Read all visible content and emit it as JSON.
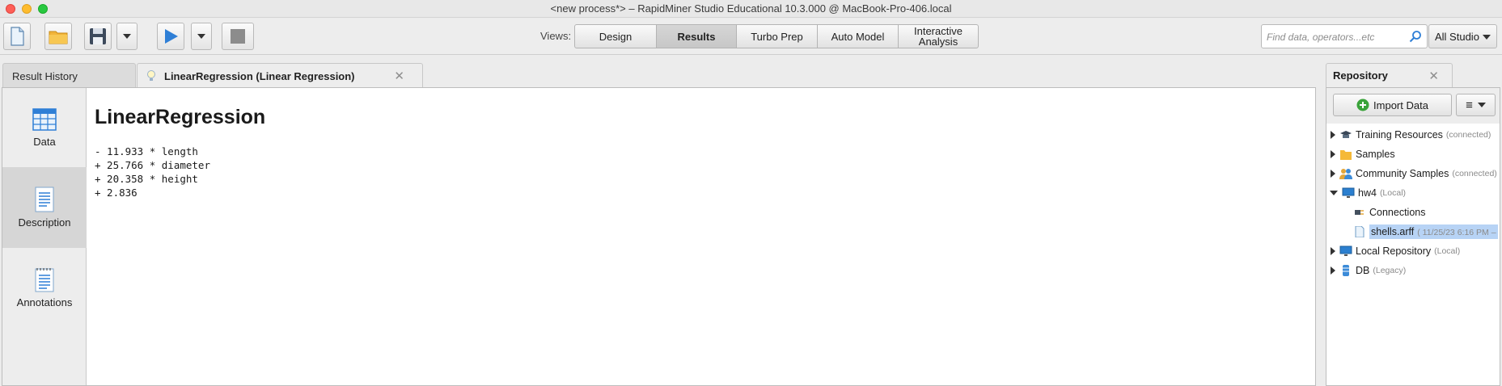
{
  "window": {
    "title": "<new process*> – RapidMiner Studio Educational 10.3.000 @ MacBook-Pro-406.local"
  },
  "toolbar": {
    "views_label": "Views:",
    "views": [
      {
        "label": "Design",
        "active": false
      },
      {
        "label": "Results",
        "active": true
      },
      {
        "label": "Turbo Prep",
        "active": false
      },
      {
        "label": "Auto Model",
        "active": false
      },
      {
        "label": "Interactive Analysis",
        "active": false
      }
    ],
    "search_placeholder": "Find data, operators...etc",
    "studio_dropdown": "All Studio"
  },
  "results": {
    "tabs": [
      {
        "label": "Result History"
      },
      {
        "label": "LinearRegression (Linear Regression)",
        "close": "✕"
      }
    ],
    "sidebar": [
      {
        "label": "Data"
      },
      {
        "label": "Description"
      },
      {
        "label": "Annotations"
      }
    ],
    "model_title": "LinearRegression",
    "formula_lines": [
      "- 11.933 * length",
      "+ 25.766 * diameter",
      "+ 20.358 * height",
      "+ 2.836"
    ]
  },
  "repository": {
    "tab_label": "Repository",
    "tab_close": "✕",
    "import_label": "Import Data",
    "menu_icon": "≡",
    "items": [
      {
        "label": "Training Resources",
        "sub": "(connected)"
      },
      {
        "label": "Samples",
        "sub": ""
      },
      {
        "label": "Community Samples",
        "sub": "(connected)"
      },
      {
        "label": "hw4",
        "sub": "(Local)"
      },
      {
        "label": "Connections",
        "sub": ""
      },
      {
        "label": "shells.arff",
        "sub": "( 11/25/23 6:16 PM –"
      },
      {
        "label": "Local Repository",
        "sub": "(Local)"
      },
      {
        "label": "DB",
        "sub": "(Legacy)"
      }
    ]
  },
  "colors": {
    "accent_blue": "#2f7fd6",
    "selection": "#b7d3f5",
    "active_tab": "#d6d6d6"
  }
}
